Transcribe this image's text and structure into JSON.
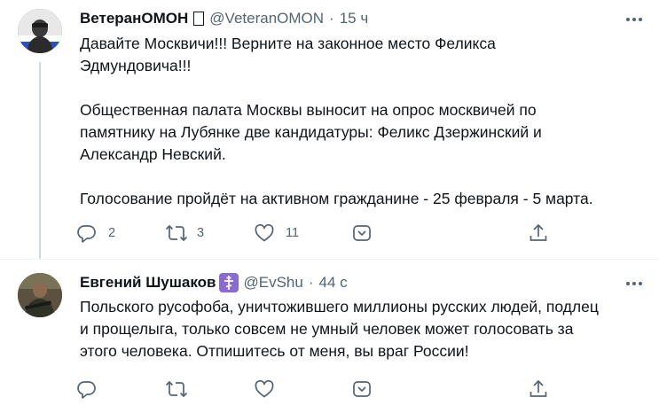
{
  "tweets": [
    {
      "author": {
        "name": "ВетеранОМОН",
        "badge": "□",
        "handle": "@VeteranOMON"
      },
      "dot": "·",
      "time": "15 ч",
      "lines": [
        "Давайте Москвичи!!! Верните на законное место Феликса",
        "Эдмундовича!!!",
        "",
        "Общественная палата Москвы выносит на опрос москвичей по",
        "памятнику на Лубянке две кандидатуры: Феликс Дзержинский и",
        "Александр Невский.",
        "",
        "Голосование пройдёт на активном гражданине - 25 февраля - 5 марта."
      ],
      "actions": {
        "reply_count": "2",
        "retweet_count": "3",
        "like_count": "11"
      },
      "icons": [
        "reply-icon",
        "retweet-icon",
        "like-icon",
        "downvote-icon",
        "share-icon",
        "more-icon"
      ]
    },
    {
      "author": {
        "name": "Евгений Шушаков",
        "badge": "orthodox-cross-badge",
        "handle": "@EvShu"
      },
      "dot": "·",
      "time": "44 с",
      "lines": [
        "Польского русофоба, уничтожившего миллионы русских людей, подлец",
        "и прощелыга, только совсем не умный человек может голосовать за",
        "этого человека. Отпишитесь от меня, вы враг России!"
      ],
      "actions": {
        "reply_count": "",
        "retweet_count": "",
        "like_count": ""
      },
      "icons": [
        "reply-icon",
        "retweet-icon",
        "like-icon",
        "downvote-icon",
        "share-icon",
        "more-icon"
      ]
    }
  ],
  "colors": {
    "text": "#0f1419",
    "secondary": "#536471",
    "thread_line": "#cfd9de",
    "badge_purple": "#8a6bcf",
    "divider": "#eff3f4"
  }
}
